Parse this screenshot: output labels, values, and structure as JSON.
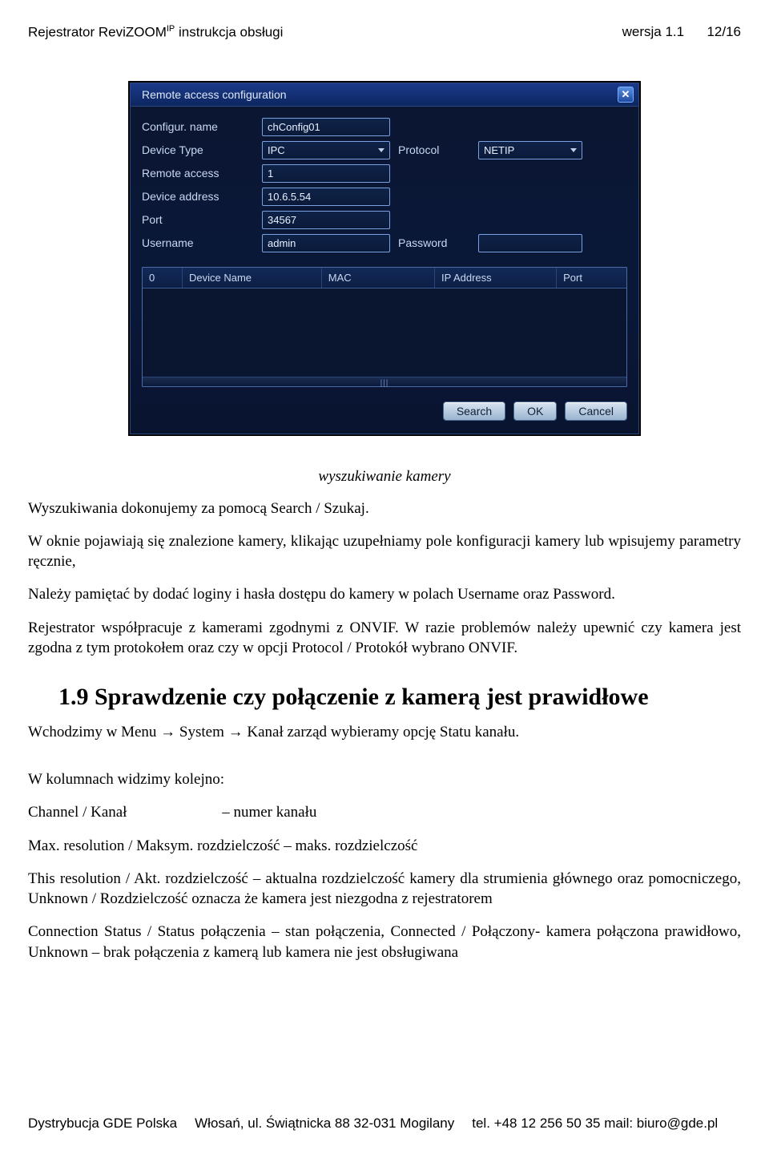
{
  "header": {
    "product": "Rejestrator ReviZOOM",
    "super": "IP",
    "subtitle": " instrukcja obsługi",
    "version": "wersja 1.1",
    "page": "12/16"
  },
  "dialog": {
    "title": "Remote access configuration",
    "close_glyph": "✕",
    "labels": {
      "configur_name": "Configur. name",
      "device_type": "Device Type",
      "protocol": "Protocol",
      "remote_access": "Remote access",
      "device_address": "Device address",
      "port": "Port",
      "username": "Username",
      "password": "Password"
    },
    "values": {
      "configur_name": "chConfig01",
      "device_type": "IPC",
      "protocol": "NETIP",
      "remote_access": "1",
      "device_address": "10.6.5.54",
      "port": "34567",
      "username": "admin",
      "password": ""
    },
    "table_headers": {
      "idx": "0",
      "device_name": "Device Name",
      "mac": "MAC",
      "ip": "IP Address",
      "port": "Port"
    },
    "buttons": {
      "search": "Search",
      "ok": "OK",
      "cancel": "Cancel"
    },
    "colors": {
      "accent_border": "#7aa0e0",
      "title_grad_top": "#1a3a8a",
      "title_grad_bottom": "#0d2660"
    }
  },
  "caption": "wyszukiwanie kamery",
  "paragraphs": {
    "p1": "Wyszukiwania dokonujemy za pomocą Search / Szukaj.",
    "p2": "W oknie pojawiają się znalezione kamery, klikając uzupełniamy pole konfiguracji kamery lub wpisujemy parametry ręcznie,",
    "p3": "Należy pamiętać by dodać loginy i hasła dostępu do kamery w polach Username oraz Password.",
    "p4": "Rejestrator współpracuje z kamerami zgodnymi z ONVIF. W razie problemów należy upewnić czy kamera jest zgodna z tym protokołem oraz czy w opcji Protocol / Protokół wybrano ONVIF.",
    "section_title": "1.9   Sprawdzenie czy połączenie z kamerą jest prawidłowe",
    "p5": "Wchodzimy w Menu → System → Kanał zarząd wybieramy opcję Statu kanału.",
    "p6": "W kolumnach widzimy kolejno:",
    "p7": "Channel / Kanał                         – numer kanału",
    "p8": "Max. resolution / Maksym. rozdzielczość – maks. rozdzielczość",
    "p9": "This resolution / Akt. rozdzielczość           – aktualna rozdzielczość kamery dla strumienia głównego oraz pomocniczego, Unknown /  Rozdzielczość oznacza że kamera jest niezgodna z rejestratorem",
    "p10": "Connection Status / Status połączenia – stan połączenia, Connected /  Połączony- kamera połączona prawidłowo, Unknown – brak połączenia z kamerą lub kamera nie jest obsługiwana"
  },
  "footer": {
    "dist": "Dystrybucja GDE Polska",
    "addr": "Włosań, ul. Świątnicka 88 32-031 Mogilany",
    "contact": "tel. +48 12 256 50 35 mail: biuro@gde.pl"
  }
}
